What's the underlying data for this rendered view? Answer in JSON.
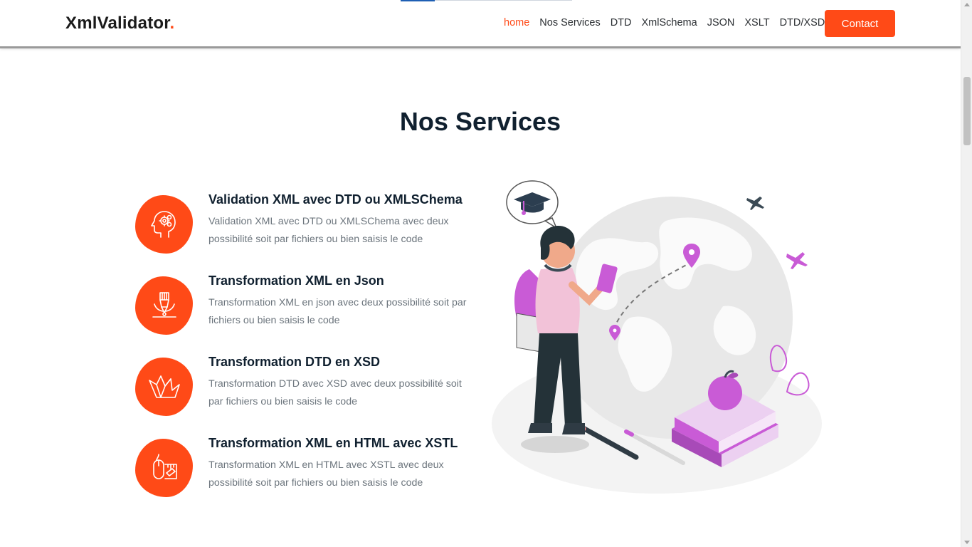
{
  "header": {
    "logo_text": "XmlValidator",
    "logo_dot": ".",
    "nav": [
      {
        "label": "home",
        "active": true
      },
      {
        "label": "Nos Services",
        "active": false
      },
      {
        "label": "DTD",
        "active": false
      },
      {
        "label": "XmlSchema",
        "active": false
      },
      {
        "label": "JSON",
        "active": false
      },
      {
        "label": "XSLT",
        "active": false
      },
      {
        "label": "DTD/XSD",
        "active": false
      }
    ],
    "contact_label": "Contact"
  },
  "main": {
    "title": "Nos Services",
    "services": [
      {
        "title": "Validation XML avec DTD ou XMLSChema",
        "description": "Validation XML avec DTD ou XMLSChema avec deux possibilité soit par fichiers ou bien saisis le code",
        "icon": "brain-head-icon"
      },
      {
        "title": "Transformation XML en Json",
        "description": "Transformation XML en json avec deux possibilité soit par fichiers ou bien saisis le code",
        "icon": "pen-nib-icon"
      },
      {
        "title": "Transformation DTD en XSD",
        "description": "Transformation DTD avec XSD avec deux possibilité soit par fichiers ou bien saisis le code",
        "icon": "paper-crane-icon"
      },
      {
        "title": "Transformation XML en HTML avec XSTL",
        "description": "Transformation XML en HTML avec XSTL avec deux possibilité soit par fichiers ou bien saisis le code",
        "icon": "mouse-tools-icon"
      }
    ]
  },
  "colors": {
    "accent": "#ff4a17",
    "heading": "#10202f",
    "text_muted": "#6c757d",
    "illustration_purple": "#c95bd6"
  }
}
